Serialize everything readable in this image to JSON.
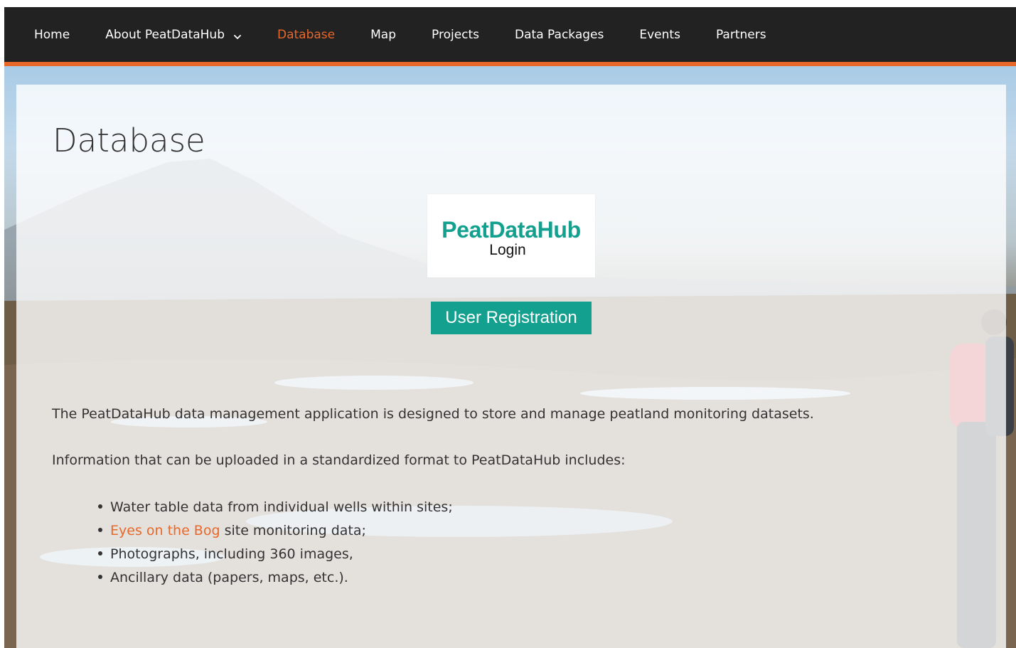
{
  "nav": {
    "items": [
      {
        "label": "Home",
        "active": false
      },
      {
        "label": "About PeatDataHub",
        "active": false,
        "has_dropdown": true
      },
      {
        "label": "Database",
        "active": true
      },
      {
        "label": "Map",
        "active": false
      },
      {
        "label": "Projects",
        "active": false
      },
      {
        "label": "Data Packages",
        "active": false
      },
      {
        "label": "Events",
        "active": false
      },
      {
        "label": "Partners",
        "active": false
      }
    ],
    "dropdown_icon": "chevron-down-icon"
  },
  "page": {
    "title": "Database",
    "login": {
      "brand": "PeatDataHub",
      "sub": "Login"
    },
    "register_label": "User Registration",
    "intro": "The PeatDataHub data management application is designed to store and manage peatland monitoring datasets.",
    "upload_intro": "Information that can be uploaded in a standardized format to PeatDataHub includes:",
    "features": [
      {
        "text": "Water table data from individual wells within sites;"
      },
      {
        "link": "Eyes on the Bog",
        "text": " site monitoring data;"
      },
      {
        "text": "Photographs, including 360 images,"
      },
      {
        "text": "Ancillary data (papers, maps, etc.)."
      }
    ]
  },
  "colors": {
    "nav_bg": "#222222",
    "accent": "#e8682a",
    "brand": "#14a08e",
    "text": "#333333"
  }
}
